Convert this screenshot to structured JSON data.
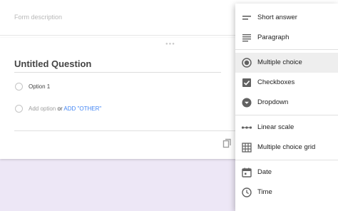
{
  "form": {
    "description_placeholder": "Form description",
    "question_title": "Untitled Question",
    "options": [
      {
        "label": "Option 1"
      }
    ],
    "add_option": {
      "label": "Add option",
      "or": "or",
      "add_other": "ADD \"OTHER\""
    }
  },
  "menu": {
    "selected": "Multiple choice",
    "items": [
      {
        "label": "Short answer",
        "icon": "short-answer-icon"
      },
      {
        "label": "Paragraph",
        "icon": "paragraph-icon"
      },
      {
        "label": "Multiple choice",
        "icon": "radio-button-icon"
      },
      {
        "label": "Checkboxes",
        "icon": "checkbox-icon"
      },
      {
        "label": "Dropdown",
        "icon": "dropdown-circle-icon"
      },
      {
        "label": "Linear scale",
        "icon": "linear-scale-icon"
      },
      {
        "label": "Multiple choice grid",
        "icon": "grid-icon"
      },
      {
        "label": "Date",
        "icon": "calendar-icon"
      },
      {
        "label": "Time",
        "icon": "clock-icon"
      }
    ]
  },
  "colors": {
    "accent_link": "#4285f4",
    "background_band": "#ede7f6",
    "selected_item": "#eeeeee",
    "icon": "#616161"
  }
}
